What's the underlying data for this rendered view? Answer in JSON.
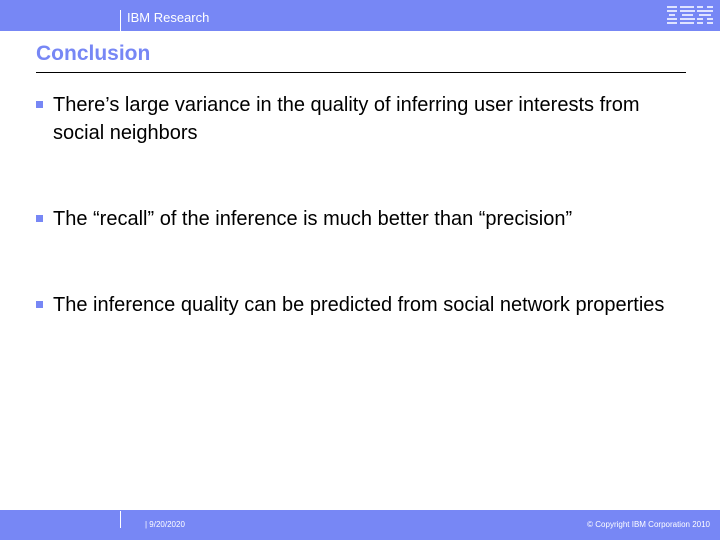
{
  "header": {
    "brand": "IBM Research",
    "logo": "ibm-logo",
    "bar_color": "#7787f5"
  },
  "slide": {
    "title": "Conclusion",
    "bullets": [
      {
        "text": "There’s large variance in the quality of inferring user interests from social neighbors"
      },
      {
        "text": "The “recall” of the inference is much better than “precision”"
      },
      {
        "text": "The inference quality can be predicted from social network properties"
      }
    ]
  },
  "footer": {
    "date": "| 9/20/2020",
    "copyright": "© Copyright IBM Corporation 2010"
  }
}
